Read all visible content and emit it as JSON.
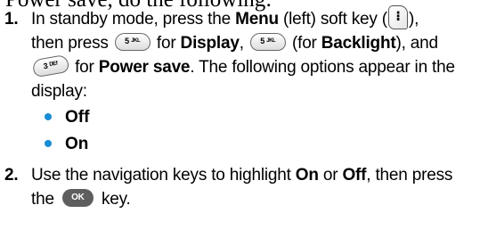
{
  "heading": "Power save, do the following:",
  "step1": {
    "number": "1.",
    "line1": {
      "a": "In standby mode, press the ",
      "b_menu": "Menu",
      "c": " (left) soft key (",
      "d": "),"
    },
    "line2": {
      "a": "then press ",
      "b": " for ",
      "b_display": "Display",
      "c": ", ",
      "d": " (for ",
      "b_backlight": "Backlight",
      "e": "), and"
    },
    "line3": {
      "a": " for ",
      "b_powersave": "Power save",
      "c": ". The following options appear in the"
    },
    "line4": "display:"
  },
  "options": [
    "Off",
    "On"
  ],
  "step2": {
    "number": "2.",
    "line1": {
      "a": "Use the navigation keys to highlight ",
      "b_on": "On",
      "c": " or ",
      "b_off": "Off",
      "d": ", then press"
    },
    "line2": {
      "a": "the ",
      "b": " key."
    }
  },
  "keys": {
    "softkey_glyph": "⁝",
    "key5_label": "5 ᴶᴷᴸ",
    "key3_label": "3 ᴰᴱᶠ",
    "ok_label": "OK"
  },
  "colors": {
    "bullet": "#1a8cd4",
    "ok_key": "#5e5e5e"
  }
}
